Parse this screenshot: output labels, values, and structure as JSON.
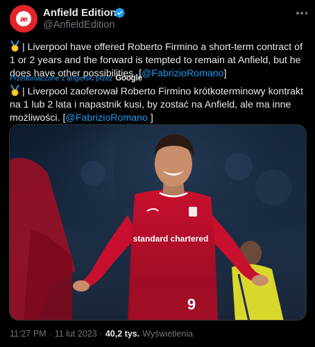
{
  "author": {
    "name": "Anfield Edition",
    "handle": "@AnfieldEdition",
    "avatar_text": "æ",
    "verified": true
  },
  "tweet": {
    "original": {
      "text": "| Liverpool have offered Roberto Firmino a short-term contract of 1 or 2 years and the forward is tempted to remain at Anfield, but he does have other possibilities. [",
      "mention": "@FabrizioRomano",
      "suffix": "]"
    },
    "translation": {
      "label": "Przetłumaczone z angielski przez",
      "provider": "Google",
      "text": "| Liverpool zaoferował Roberto Firmino krótkoterminowy kontrakt na 1 lub 2 lata i napastnik kusi, by zostać na Anfield, ale ma inne możliwości. [",
      "mention": "@FabrizioRomano",
      "suffix": " ]"
    }
  },
  "media": {
    "jersey_sponsor": "standard chartered",
    "jersey_number": "9"
  },
  "footer": {
    "time": "11:27 PM",
    "separator": "·",
    "date": "11 lut 2023",
    "views_count": "40,2 tys.",
    "views_label": "Wyświetlenia"
  },
  "colors": {
    "background": "#000000",
    "text": "#e7e9ea",
    "secondary": "#71767b",
    "link": "#1d9bf0",
    "brand": "#e3242b",
    "verified": "#1d9bf0"
  }
}
